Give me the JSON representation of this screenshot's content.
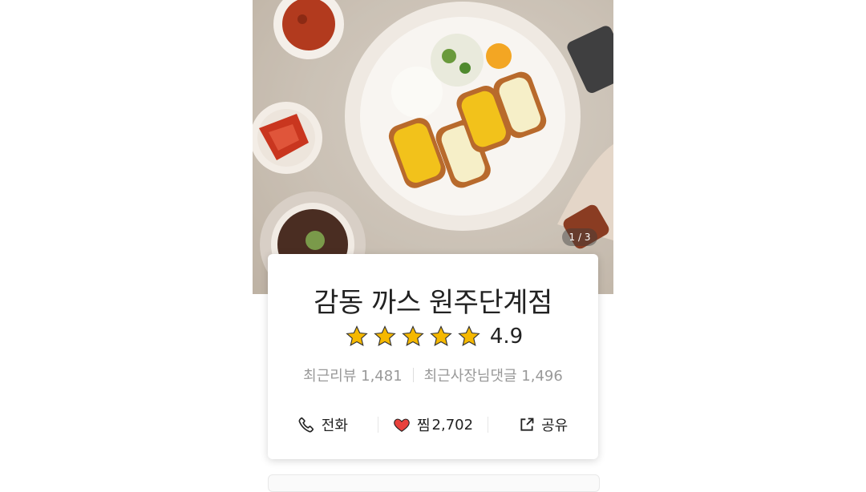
{
  "gallery": {
    "counter": "1 / 3"
  },
  "store": {
    "name": "감동 까스 원주단계점",
    "rating": "4.9",
    "recent_reviews": "최근리뷰 1,481",
    "owner_replies": "최근사장님댓글 1,496"
  },
  "actions": {
    "call_label": "전화",
    "favorite_label": "찜",
    "favorite_count": "2,702",
    "share_label": "공유"
  },
  "colors": {
    "star": "#f5b800",
    "heart": "#e8413c"
  }
}
